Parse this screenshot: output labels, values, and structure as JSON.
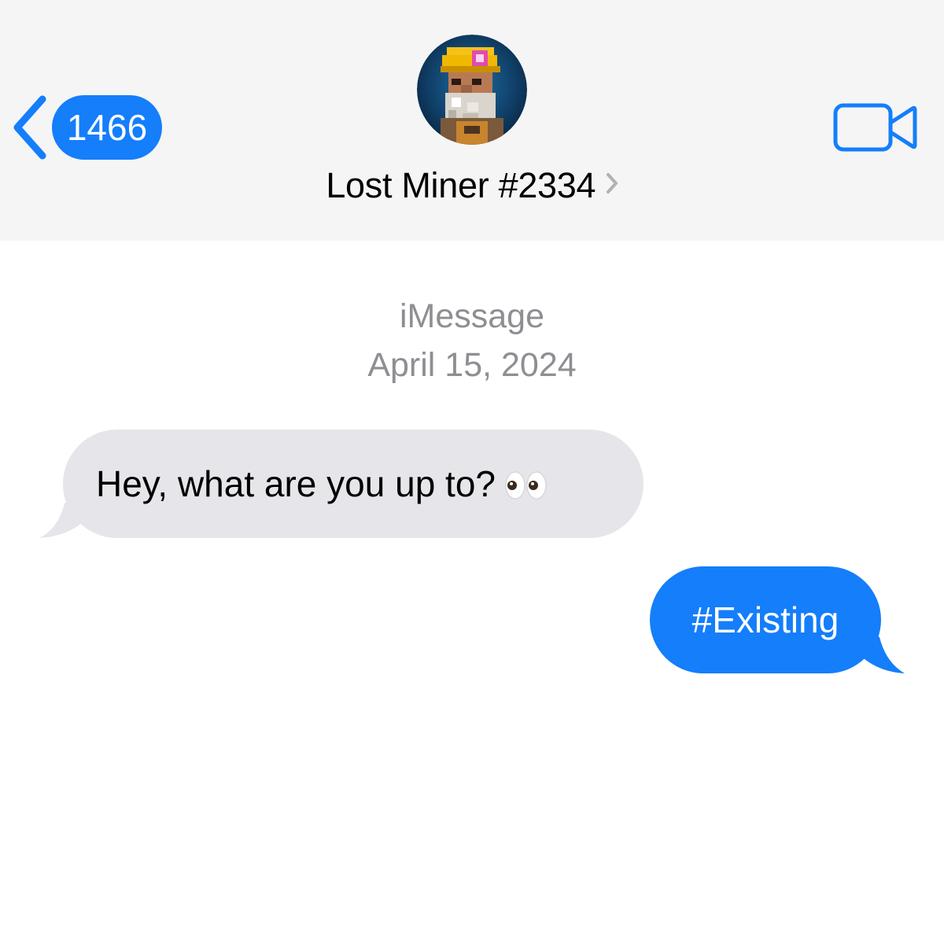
{
  "header": {
    "back_badge_count": "1466",
    "contact_name": "Lost Miner #2334",
    "avatar_icon": "pixel-miner-avatar",
    "video_icon": "video-camera-icon",
    "accent_color": "#147efb",
    "background_color": "#f5f5f5"
  },
  "conversation": {
    "service": "iMessage",
    "date": "April 15, 2024",
    "messages": [
      {
        "direction": "received",
        "text": "Hey, what are you up to?",
        "emoji": "eyes-emoji",
        "bubble_color": "#e5e5ea"
      },
      {
        "direction": "sent",
        "text": "#Existing",
        "bubble_color": "#147efb"
      }
    ]
  }
}
